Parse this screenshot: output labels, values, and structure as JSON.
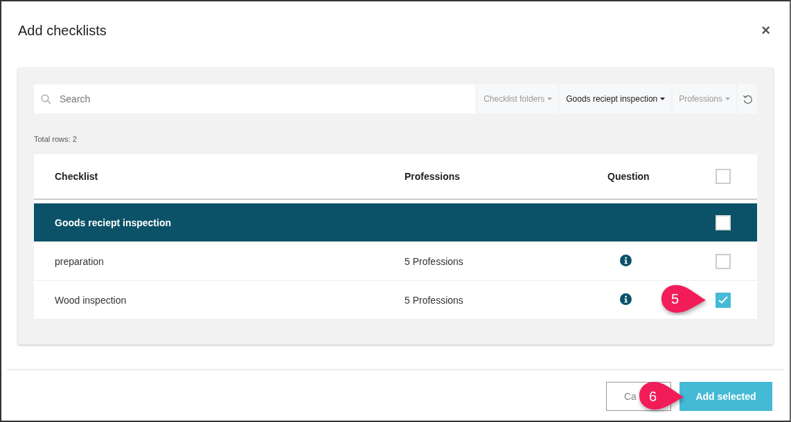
{
  "dialog": {
    "title": "Add checklists",
    "close": "×"
  },
  "search": {
    "placeholder": "Search"
  },
  "filters": [
    {
      "label": "Checklist folders",
      "active": false
    },
    {
      "label": "Goods reciept inspection",
      "active": true
    },
    {
      "label": "Professions",
      "active": false
    }
  ],
  "total_rows": "Total rows: 2",
  "table": {
    "columns": [
      "Checklist",
      "Professions",
      "Question"
    ],
    "all_checked": false,
    "rows": [
      {
        "kind": "group",
        "checklist": "Goods reciept inspection",
        "checked": false
      },
      {
        "kind": "item",
        "checklist": "preparation",
        "professions": "5 Professions",
        "checked": false
      },
      {
        "kind": "item",
        "checklist": "Wood inspection",
        "professions": "5 Professions",
        "checked": true,
        "callout": "5"
      }
    ]
  },
  "footer": {
    "cancel": "Ca",
    "submit": "Add selected",
    "callout": "6"
  }
}
